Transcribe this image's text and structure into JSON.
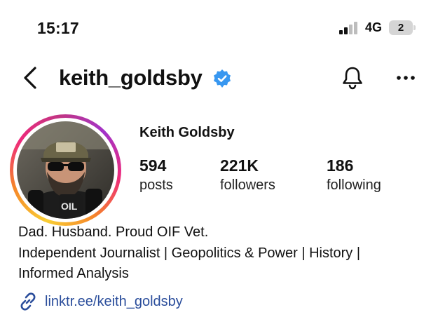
{
  "status_bar": {
    "time": "15:17",
    "network": "4G",
    "battery_level": "2"
  },
  "header": {
    "username": "keith_goldsby",
    "verified": true
  },
  "profile": {
    "display_name": "Keith Goldsby",
    "stats": {
      "posts": {
        "value": "594",
        "label": "posts"
      },
      "followers": {
        "value": "221K",
        "label": "followers"
      },
      "following": {
        "value": "186",
        "label": "following"
      }
    }
  },
  "bio": {
    "lines": [
      "Dad. Husband. Proud OIF Vet.",
      "Independent Journalist | Geopolitics & Power | History |",
      "Informed Analysis"
    ],
    "link": "linktr.ee/keith_goldsby"
  },
  "colors": {
    "verified_blue": "#3897f0",
    "link_blue": "#2a4d9b"
  },
  "icons": [
    "back-chevron-icon",
    "verified-badge-icon",
    "bell-icon",
    "more-options-icon",
    "link-icon",
    "signal-icon",
    "battery-icon"
  ]
}
